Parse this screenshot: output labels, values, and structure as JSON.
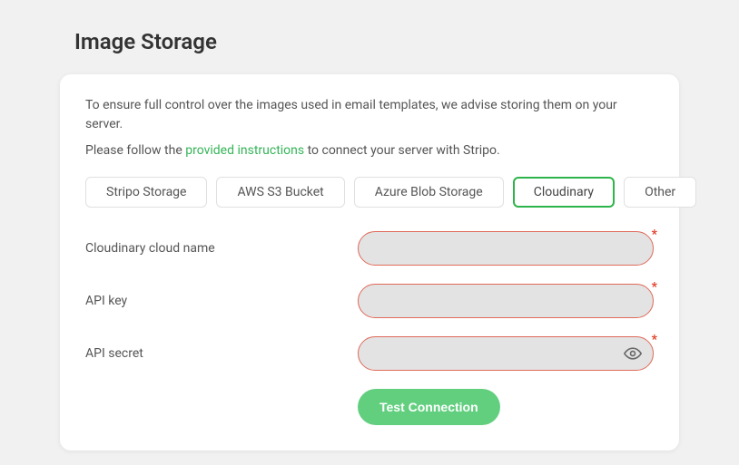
{
  "page": {
    "title": "Image Storage"
  },
  "intro": {
    "line1": "To ensure full control over the images used in email templates, we advise storing them on your server.",
    "line2_pre": "Please follow the ",
    "line2_link": "provided instructions",
    "line2_post": " to connect your server with Stripo."
  },
  "tabs": {
    "stripo": "Stripo Storage",
    "aws": "AWS S3 Bucket",
    "azure": "Azure Blob Storage",
    "cloudinary": "Cloudinary",
    "other": "Other",
    "active": "cloudinary"
  },
  "form": {
    "cloud_name": {
      "label": "Cloudinary cloud name",
      "value": ""
    },
    "api_key": {
      "label": "API key",
      "value": ""
    },
    "api_secret": {
      "label": "API secret",
      "value": ""
    }
  },
  "buttons": {
    "test_connection": "Test Connection"
  },
  "required_marker": "*"
}
